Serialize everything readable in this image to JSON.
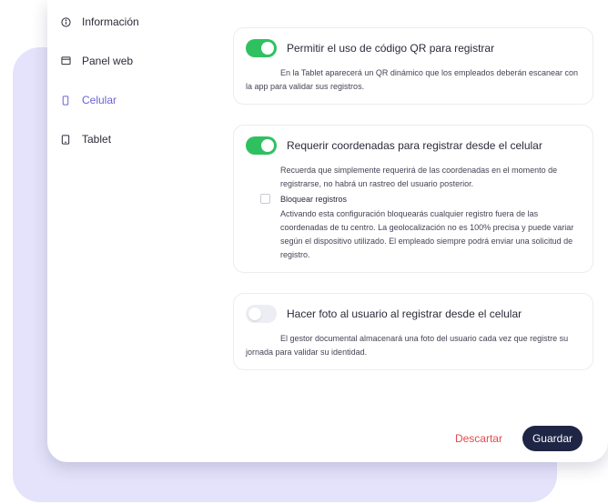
{
  "sidebar": {
    "items": [
      {
        "label": "Información",
        "icon": "info-icon",
        "active": false
      },
      {
        "label": "Panel web",
        "icon": "monitor-icon",
        "active": false
      },
      {
        "label": "Celular",
        "icon": "smartphone-icon",
        "active": true
      },
      {
        "label": "Tablet",
        "icon": "tablet-icon",
        "active": false
      }
    ]
  },
  "settings": {
    "qr": {
      "label": "Permitir el uso de código QR para registrar",
      "enabled": true,
      "description": "En la Tablet aparecerá un QR dinámico que los empleados deberán escanear con la app para validar sus registros."
    },
    "coords": {
      "label": "Requerir coordenadas para registrar desde el celular",
      "enabled": true,
      "description": "Recuerda que simplemente requerirá de las coordenadas en el momento de registrarse, no habrá un rastreo del usuario posterior.",
      "block": {
        "label": "Bloquear registros",
        "checked": false,
        "description": "Activando esta configuración bloquearás cualquier registro fuera de las coordenadas de tu centro. La geolocalización no es 100% precisa y puede variar según el dispositivo utilizado. El empleado siempre podrá enviar una solicitud de registro."
      }
    },
    "photo": {
      "label": "Hacer foto al usuario al registrar desde el celular",
      "enabled": false,
      "description": "El gestor documental almacenará una foto del usuario cada vez que registre su jornada para validar su identidad."
    }
  },
  "footer": {
    "discard_label": "Descartar",
    "save_label": "Guardar"
  },
  "colors": {
    "accent": "#6a63d8",
    "toggle_on": "#2fc160",
    "discard": "#e3494f",
    "save_bg": "#1f2544",
    "backdrop": "#e4e3fb"
  }
}
